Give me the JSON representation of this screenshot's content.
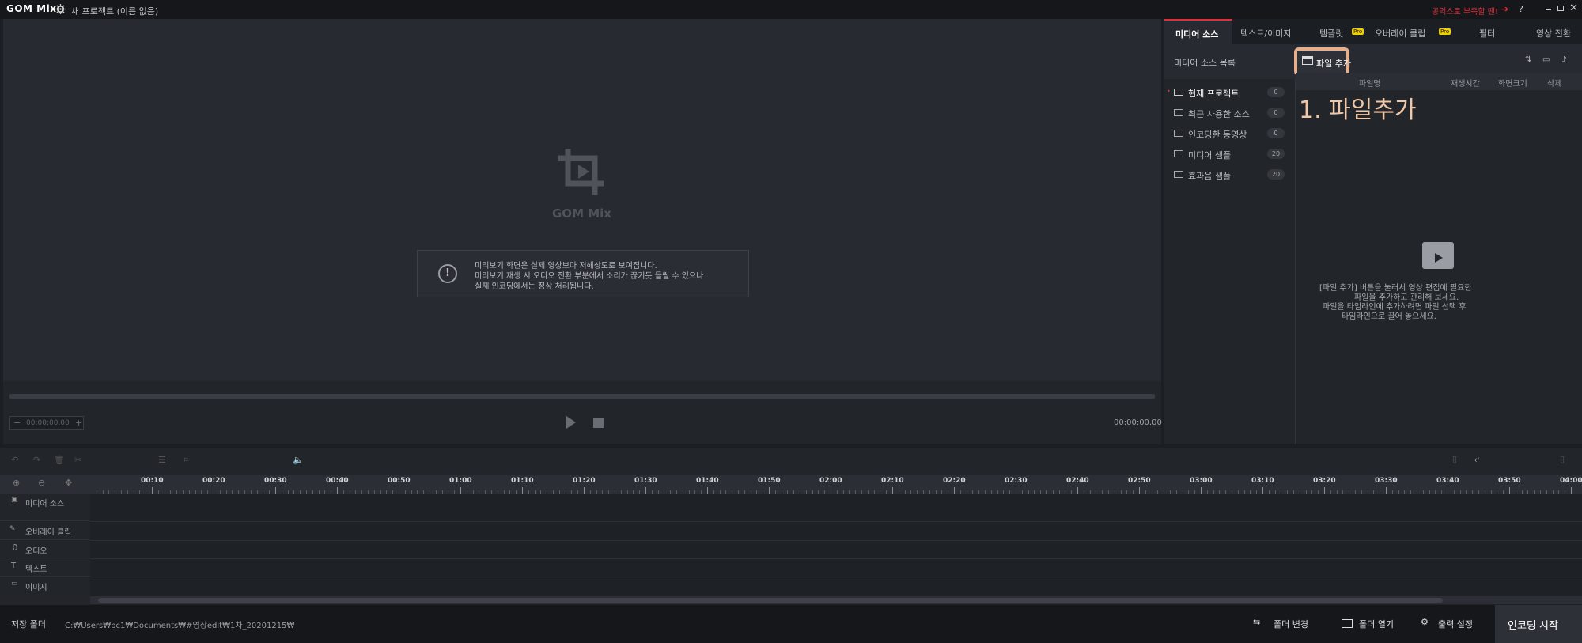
{
  "titlebar": {
    "logo": "GOM Mix",
    "project_title": "새 프로젝트 (이름 없음)",
    "promo": "공익스로 부족할 땐!",
    "help": "?"
  },
  "preview": {
    "watermark": "GOM Mix",
    "notice_line1": "미리보기 화면은 실제 영상보다 저해상도로 보여집니다.",
    "notice_line2": "미리보기 재생 시 오디오 전환 부분에서 소리가 끊기듯 들릴 수 있으나",
    "notice_line3": "실제 인코딩에서는 정상 처리됩니다.",
    "zoom_time": "00:00:00.00",
    "time": "00:00:00.00"
  },
  "tabs": [
    {
      "label": "미디어 소스",
      "pro": ""
    },
    {
      "label": "텍스트/이미지",
      "pro": ""
    },
    {
      "label": "템플릿",
      "pro": "Pro"
    },
    {
      "label": "오버레이 클립",
      "pro": "Pro"
    },
    {
      "label": "필터",
      "pro": ""
    },
    {
      "label": "영상 전환",
      "pro": ""
    }
  ],
  "media": {
    "list_title": "미디어 소스 목록",
    "add_file_label": "파일 추가",
    "annotation": "1. 파일추가",
    "folders": [
      {
        "label": "현재 프로젝트",
        "count": "0"
      },
      {
        "label": "최근 사용한 소스",
        "count": "0"
      },
      {
        "label": "인코딩한 동영상",
        "count": "0"
      },
      {
        "label": "미디어 샘플",
        "count": "20"
      },
      {
        "label": "효과음 샘플",
        "count": "20"
      }
    ],
    "columns": [
      "파일명",
      "재생시간",
      "화면크기",
      "삭제"
    ],
    "empty_line1": "[파일 추가] 버튼을 눌러서 영상 편집에 필요한",
    "empty_line2": "파일을 추가하고 관리해 보세요.",
    "empty_line3": "파일을 타임라인에 추가하려면 파일 선택 후",
    "empty_line4": "타임라인으로 끌어 놓으세요."
  },
  "timeline": {
    "ticks": [
      "00:10",
      "00:20",
      "00:30",
      "00:40",
      "00:50",
      "01:00",
      "01:10",
      "01:20",
      "01:30",
      "01:40",
      "01:50",
      "02:00",
      "02:10",
      "02:20",
      "02:30",
      "02:40",
      "02:50",
      "03:00",
      "03:10",
      "03:20",
      "03:30",
      "03:40",
      "03:50",
      "04:00"
    ],
    "tracks": [
      {
        "label": "미디어 소스",
        "icon": "media-icon"
      },
      {
        "label": "오버레이 클립",
        "icon": "overlay-icon"
      },
      {
        "label": "오디오",
        "icon": "audio-icon"
      },
      {
        "label": "텍스트",
        "icon": "text-icon"
      },
      {
        "label": "이미지",
        "icon": "image-icon"
      }
    ]
  },
  "bottom": {
    "save_folder_label": "저장 폴더",
    "save_path": "C:₩Users₩pc1₩Documents₩#영상edit₩1차_20201215₩",
    "change_folder": "폴더 변경",
    "open_folder": "폴더 열기",
    "output_settings": "출력 설정",
    "start_encoding": "인코딩 시작"
  },
  "colors": {
    "accent_red": "#e0303a",
    "highlight_box": "#e8b08a",
    "annotation_text": "#f0c8a8",
    "pro_badge": "#f0d000"
  }
}
